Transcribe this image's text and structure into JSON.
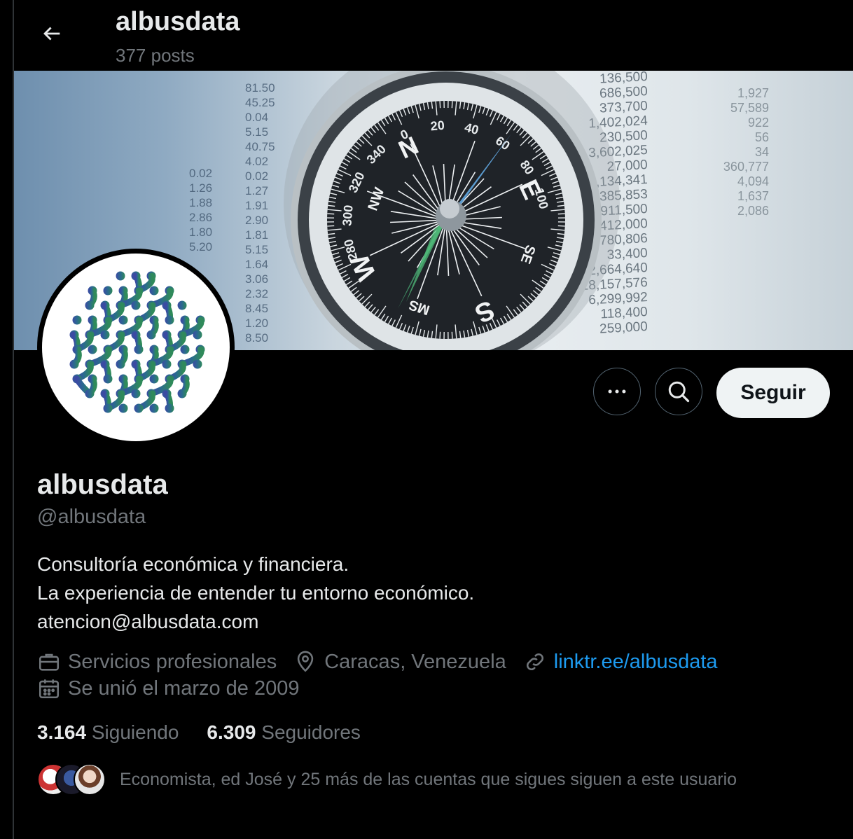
{
  "header": {
    "title": "albusdata",
    "posts_count": "377 posts"
  },
  "banner": {
    "description": "compass over financial tables",
    "compass_letters": [
      "N",
      "E",
      "S",
      "W",
      "NW",
      "SE",
      "MS"
    ],
    "dial_numbers": [
      "0",
      "20",
      "40",
      "60",
      "80",
      "100",
      "280",
      "300",
      "320",
      "340"
    ],
    "table_numbers": [
      "136,500",
      "686,500",
      "373,700",
      "1,402,024",
      "230,500",
      "3,602,025",
      "27,000",
      "189,134,341",
      "1,385,853",
      "911,500",
      "412,000",
      "9,780,806",
      "33,400",
      "62,664,640",
      "18,157,576",
      "6,299,992",
      "118,400",
      "259,000"
    ],
    "left_numbers": [
      "81.50",
      "45.25",
      "0.04",
      "5.15",
      "40.75",
      "4.02",
      "0.02",
      "1.27",
      "1.91",
      "2.90",
      "1.81",
      "5.15",
      "1.64",
      "3.06",
      "2.32",
      "8.45",
      "1.20",
      "8.50"
    ],
    "left_numbers_2": [
      "0.02",
      "1.26",
      "1.88",
      "2.86",
      "1.80",
      "5.20"
    ],
    "right_numbers": [
      "1,927",
      "57,589",
      "922",
      "56",
      "34",
      "360,777",
      "4,094",
      "1,637",
      "2,086"
    ]
  },
  "actions": {
    "more_icon": "ellipsis-icon",
    "search_icon": "search-icon",
    "follow_label": "Seguir"
  },
  "profile": {
    "name": "albusdata",
    "handle": "@albusdata",
    "bio_lines": [
      "Consultoría económica y financiera.",
      "La experiencia de entender tu entorno económico.",
      "atencion@albusdata.com"
    ],
    "category": "Servicios profesionales",
    "location": "Caracas, Venezuela",
    "website": "linktr.ee/albusdata",
    "joined": "Se unió el marzo de 2009"
  },
  "stats": {
    "following_count": "3.164",
    "following_label": "Siguiendo",
    "followers_count": "6.309",
    "followers_label": "Seguidores"
  },
  "followed_by": {
    "text": "Economista, ed José y 25 más de las cuentas que sigues siguen a este usuario"
  },
  "colors": {
    "background": "#000000",
    "text": "#e7e9ea",
    "muted": "#71767b",
    "link": "#1d9bf0",
    "button_bg": "#eff3f4"
  }
}
